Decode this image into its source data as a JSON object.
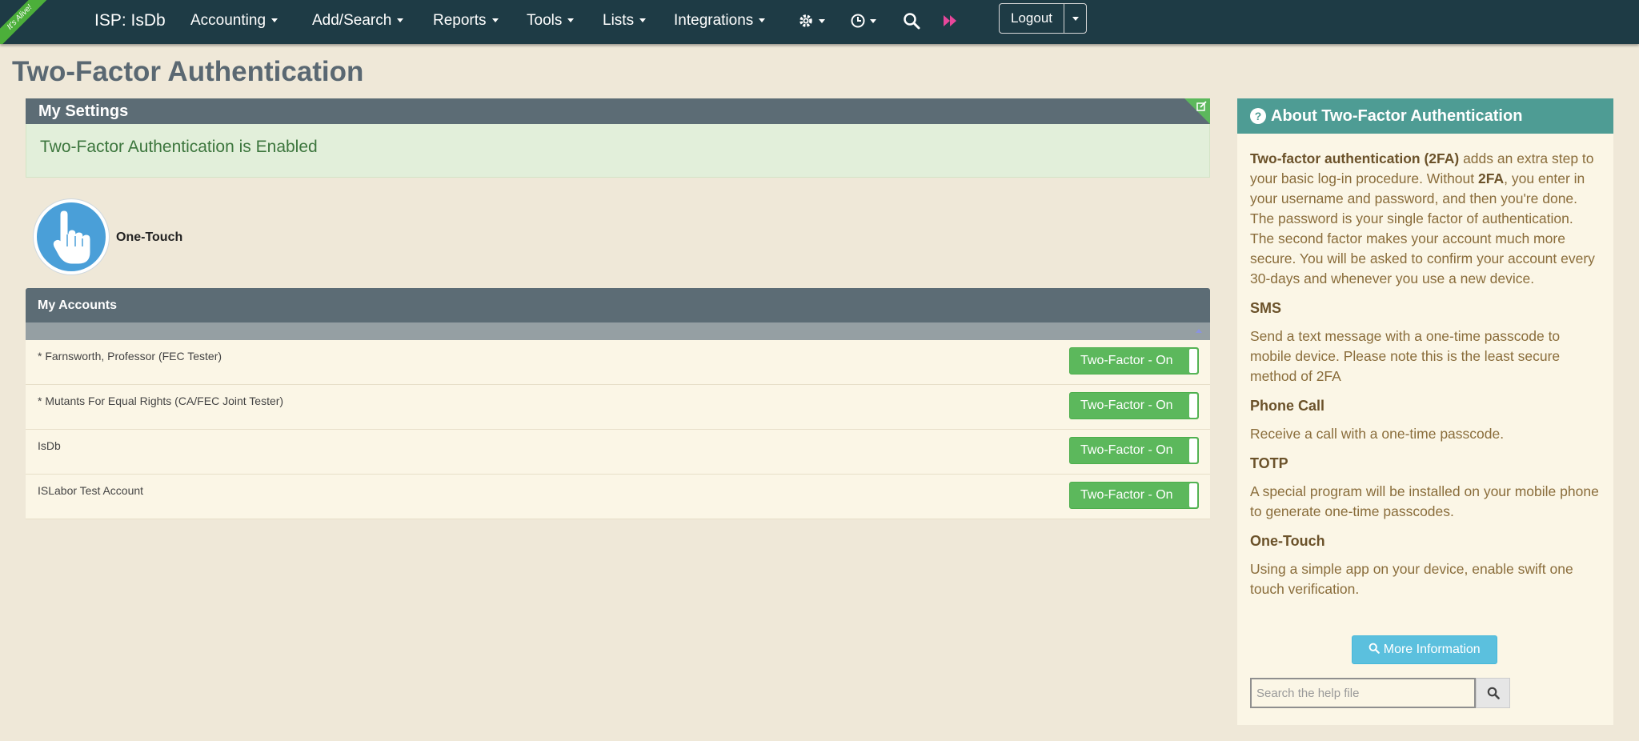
{
  "ribbon": "It's Alive!",
  "brand": "ISP: IsDb",
  "nav": {
    "menus": [
      "Accounting",
      "Add/Search",
      "Reports",
      "Tools",
      "Lists",
      "Integrations"
    ],
    "icons": [
      "gear-icon",
      "clock-icon",
      "search-icon",
      "fast-forward-icon"
    ],
    "logout": "Logout"
  },
  "page_title": "Two-Factor Authentication",
  "settings": {
    "title": "My Settings",
    "status": "Two-Factor Authentication is Enabled",
    "method": "One-Touch"
  },
  "accounts": {
    "title": "My Accounts",
    "rows": [
      {
        "name": "* Farnsworth, Professor (FEC Tester)",
        "toggle": "Two-Factor - On"
      },
      {
        "name": "* Mutants For Equal Rights (CA/FEC Joint Tester)",
        "toggle": "Two-Factor - On"
      },
      {
        "name": "IsDb",
        "toggle": "Two-Factor - On"
      },
      {
        "name": "ISLabor Test Account",
        "toggle": "Two-Factor - On"
      }
    ]
  },
  "about": {
    "title": "About Two-Factor Authentication",
    "intro_bold": "Two-factor authentication (2FA)",
    "intro_a": " adds an extra step to your basic log-in procedure. Without ",
    "intro_bold2": "2FA",
    "intro_b": ", you enter in your username and password, and then you're done. The password is your single factor of authentication. The second factor makes your account much more secure. You will be asked to confirm your account every 30-days and whenever you use a new device.",
    "sections": [
      {
        "heading": "SMS",
        "text": "Send a text message with a one-time passcode to mobile device. Please note this is the least secure method of 2FA"
      },
      {
        "heading": "Phone Call",
        "text": "Receive a call with a one-time passcode."
      },
      {
        "heading": "TOTP",
        "text": "A special program will be installed on your mobile phone to generate one-time passcodes."
      },
      {
        "heading": "One-Touch",
        "text": "Using a simple app on your device, enable swift one touch verification."
      }
    ],
    "more_button": "More Information",
    "search_placeholder": "Search the help file"
  },
  "colors": {
    "navbar": "#1e3b45",
    "panel_header": "#5c6c75",
    "success": "#5cb85c",
    "info": "#5bc0de",
    "about_header": "#4e9c94",
    "background": "#efe8d8"
  }
}
